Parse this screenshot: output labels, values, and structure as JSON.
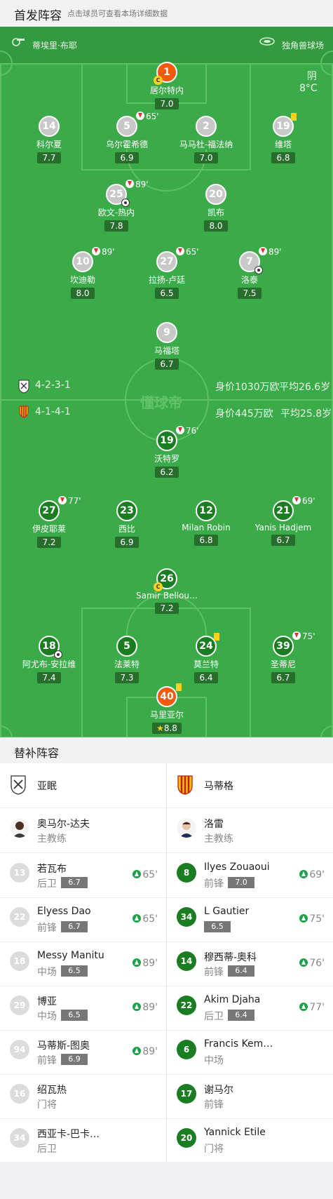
{
  "header": {
    "title": "首发阵容",
    "hint": "点击球员可查看本场详细数据"
  },
  "pitch": {
    "referee": "蒂埃里·布耶",
    "stadium": "独角兽球场",
    "weather": "阴",
    "temperature": "8°C",
    "watermark": "懂球帝",
    "home_formation": "4-2-3-1",
    "home_value": "身价1030万欧",
    "home_age": "平均26.6岁",
    "away_formation": "4-1-4-1",
    "away_value": "身价445万欧",
    "away_age": "平均25.8岁"
  },
  "home_players": [
    {
      "num": "1",
      "name": "居尔特内",
      "rating": "7.0"
    },
    {
      "num": "14",
      "name": "科尔夏",
      "rating": "7.7"
    },
    {
      "num": "5",
      "name": "乌尔霍希德",
      "rating": "6.9",
      "sub": "65'"
    },
    {
      "num": "2",
      "name": "马马杜-福法纳",
      "rating": "7.0"
    },
    {
      "num": "19",
      "name": "维塔",
      "rating": "6.8"
    },
    {
      "num": "25",
      "name": "欧文-热内",
      "rating": "7.8",
      "sub": "89'"
    },
    {
      "num": "20",
      "name": "凯布",
      "rating": "8.0"
    },
    {
      "num": "10",
      "name": "坎迪勒",
      "rating": "8.0",
      "sub": "89'"
    },
    {
      "num": "27",
      "name": "拉扬-卢廷",
      "rating": "6.5",
      "sub": "65'"
    },
    {
      "num": "7",
      "name": "洛泰",
      "rating": "7.5",
      "sub": "89'"
    },
    {
      "num": "9",
      "name": "马福塔",
      "rating": "6.7"
    }
  ],
  "away_players": [
    {
      "num": "19",
      "name": "沃特罗",
      "rating": "6.2",
      "sub": "76'"
    },
    {
      "num": "27",
      "name": "伊皮耶莱",
      "rating": "7.2",
      "sub": "77'"
    },
    {
      "num": "23",
      "name": "西比",
      "rating": "6.9"
    },
    {
      "num": "12",
      "name": "Milan Robin",
      "rating": "6.8"
    },
    {
      "num": "21",
      "name": "Yanis Hadjem",
      "rating": "6.7",
      "sub": "69'"
    },
    {
      "num": "26",
      "name": "Samir Bellou…",
      "rating": "7.2"
    },
    {
      "num": "18",
      "name": "阿尤布-安拉维",
      "rating": "7.4"
    },
    {
      "num": "5",
      "name": "法莱特",
      "rating": "7.3"
    },
    {
      "num": "24",
      "name": "莫兰特",
      "rating": "6.4"
    },
    {
      "num": "39",
      "name": "圣蒂尼",
      "rating": "6.7",
      "sub": "75'"
    },
    {
      "num": "40",
      "name": "马里亚尔",
      "rating": "8.8"
    }
  ],
  "subs_title": "替补阵容",
  "home_team": {
    "name": "亚眠",
    "coach": "奥马尔-达夫",
    "coach_role": "主教练",
    "subs": [
      {
        "num": "13",
        "name": "若瓦布",
        "pos": "后卫",
        "rating": "6.7",
        "on": "65'"
      },
      {
        "num": "22",
        "name": "Elyess Dao",
        "pos": "前锋",
        "rating": "6.7",
        "on": "65'"
      },
      {
        "num": "18",
        "name": "Messy Manitu",
        "pos": "中场",
        "rating": "6.5",
        "on": "89'"
      },
      {
        "num": "29",
        "name": "博亚",
        "pos": "中场",
        "rating": "6.5",
        "on": "89'"
      },
      {
        "num": "94",
        "name": "马蒂斯-图奥",
        "pos": "前锋",
        "rating": "6.9",
        "on": "89'"
      },
      {
        "num": "16",
        "name": "绍瓦热",
        "pos": "门将"
      },
      {
        "num": "34",
        "name": "西亚卡-巴卡…",
        "pos": "后卫"
      }
    ]
  },
  "away_team": {
    "name": "马蒂格",
    "coach": "洛雷",
    "coach_role": "主教练",
    "subs": [
      {
        "num": "8",
        "name": "Ilyes Zouaoui",
        "pos": "前锋",
        "rating": "7.0",
        "on": "69'"
      },
      {
        "num": "34",
        "name": "L Gautier",
        "pos": "",
        "rating": "6.5",
        "on": "75'"
      },
      {
        "num": "14",
        "name": "穆西蒂-奥科",
        "pos": "前锋",
        "rating": "6.4",
        "on": "76'"
      },
      {
        "num": "22",
        "name": "Akim Djaha",
        "pos": "后卫",
        "rating": "6.4",
        "on": "77'"
      },
      {
        "num": "6",
        "name": "Francis Kem…",
        "pos": "中场"
      },
      {
        "num": "17",
        "name": "谢马尔",
        "pos": "前锋"
      },
      {
        "num": "20",
        "name": "Yannick Etile",
        "pos": "门将"
      }
    ]
  }
}
